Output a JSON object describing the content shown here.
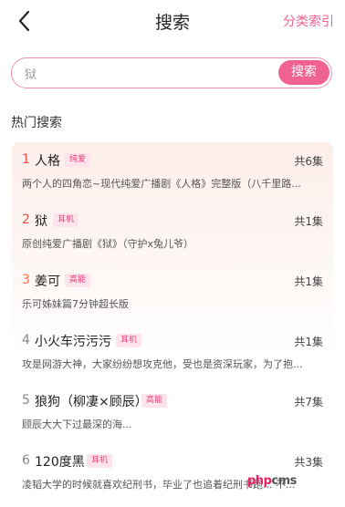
{
  "header": {
    "title": "搜索",
    "category_link": "分类索引",
    "back_icon": "chevron-left-icon"
  },
  "search": {
    "value": "狱",
    "button_label": "搜索"
  },
  "hot": {
    "title": "热门搜索",
    "items": [
      {
        "rank": "1",
        "name": "人格",
        "tag": "纯爱",
        "count": "共6集",
        "desc": "两个人的四角恋~现代纯爱广播剧《人格》完整版（八千里路..."
      },
      {
        "rank": "2",
        "name": "狱",
        "tag": "耳机",
        "count": "共1集",
        "desc": "原创纯爱广播剧《狱》（守护x兔儿爷）"
      },
      {
        "rank": "3",
        "name": "姜可",
        "tag": "高能",
        "count": "共1集",
        "desc": "乐可姊妹篇7分钟超长版"
      },
      {
        "rank": "4",
        "name": "小火车污污污",
        "tag": "耳机",
        "count": "共1集",
        "desc": "攻是网游大神，大家纷纷想攻克他，受也是资深玩家，为了抱..."
      },
      {
        "rank": "5",
        "name": "狼狗（柳凄×顾辰）",
        "tag": "高能",
        "count": "共7集",
        "desc": "顾辰大大下过最深的海..."
      },
      {
        "rank": "6",
        "name": "120度黑",
        "tag": "耳机",
        "count": "共3集",
        "desc": "凌韬大学的时候就喜欢纪刑书，毕业了也追着纪刑书跑... 不..."
      }
    ]
  },
  "colors": {
    "accent": "#f06292",
    "rank_top": "#ef5350",
    "rank_third": "#ff7043",
    "rank_normal": "#888888",
    "tag_bg": "#fde4ec"
  },
  "watermark": {
    "brand": "php",
    "rest": "cms"
  }
}
